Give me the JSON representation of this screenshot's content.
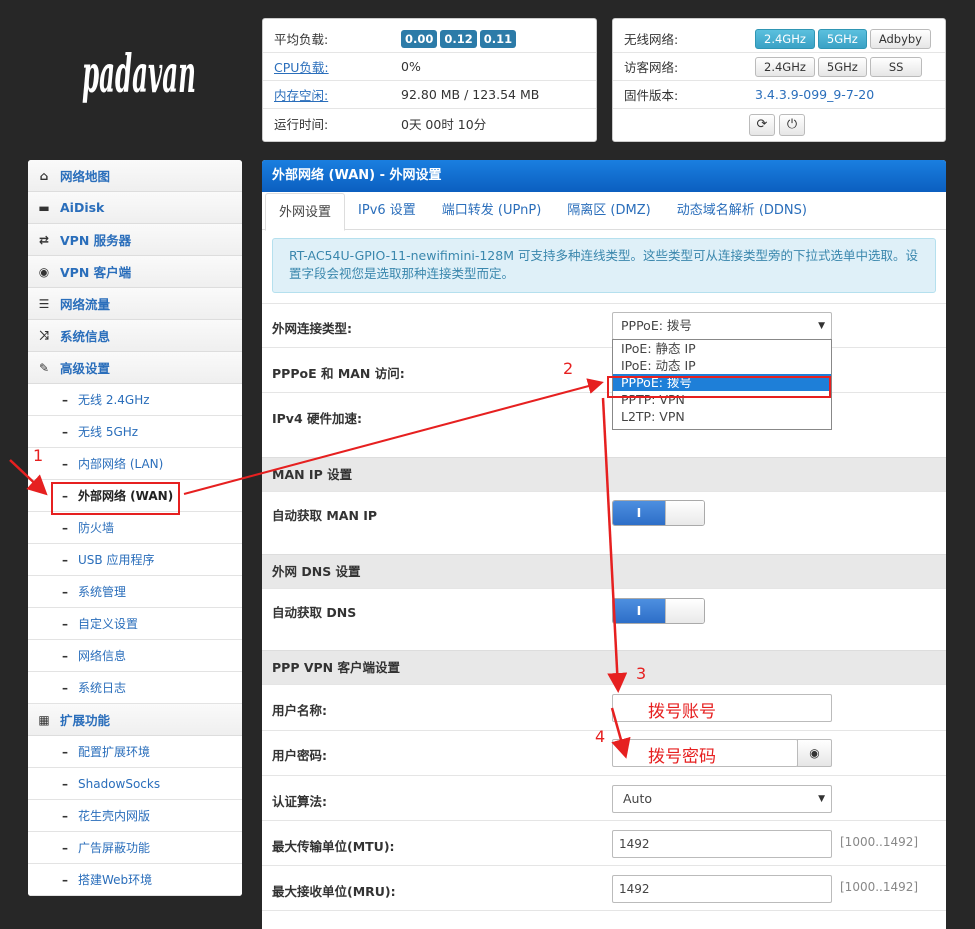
{
  "brand": "padavan",
  "status": {
    "load_label": "平均负载:",
    "load_values": [
      "0.00",
      "0.12",
      "0.11"
    ],
    "cpu_label": "CPU负载:",
    "cpu_value": "0%",
    "mem_label": "内存空闲:",
    "mem_value": "92.80 MB / 123.54 MB",
    "uptime_label": "运行时间:",
    "uptime_value": "0天 00时 10分",
    "wireless_label": "无线网络:",
    "wireless_24": "2.4GHz",
    "wireless_5": "5GHz",
    "adbyby": "Adbyby",
    "guest_label": "访客网络:",
    "guest_24": "2.4GHz",
    "guest_5": "5GHz",
    "ss": "SS",
    "fw_label": "固件版本:",
    "fw_value": "3.4.3.9-099_9-7-20"
  },
  "sidebar": {
    "items": [
      {
        "label": "网络地图",
        "icon": "home-icon",
        "glyph": "⌂"
      },
      {
        "label": "AiDisk",
        "icon": "disk-icon",
        "glyph": "▬"
      },
      {
        "label": "VPN 服务器",
        "icon": "retweet-icon",
        "glyph": "⇄"
      },
      {
        "label": "VPN 客户端",
        "icon": "globe-icon",
        "glyph": "◉"
      },
      {
        "label": "网络流量",
        "icon": "list-icon",
        "glyph": "☰"
      },
      {
        "label": "系统信息",
        "icon": "random-icon",
        "glyph": "⤨"
      },
      {
        "label": "高级设置",
        "icon": "wrench-icon",
        "glyph": "✎"
      }
    ],
    "sub_items": [
      "无线 2.4GHz",
      "无线 5GHz",
      "内部网络 (LAN)",
      "外部网络 (WAN)",
      "防火墙",
      "USB 应用程序",
      "系统管理",
      "自定义设置",
      "网络信息",
      "系统日志"
    ],
    "ext_label": "扩展功能",
    "ext_items": [
      "配置扩展环境",
      "ShadowSocks",
      "花生壳内网版",
      "广告屏蔽功能",
      "搭建Web环境"
    ]
  },
  "main": {
    "header": "外部网络 (WAN) - 外网设置",
    "tabs": [
      "外网设置",
      "IPv6 设置",
      "端口转发 (UPnP)",
      "隔离区 (DMZ)",
      "动态域名解析 (DDNS)"
    ],
    "info": "RT-AC54U-GPIO-11-newifimini-128M 可支持多种连线类型。这些类型可从连接类型旁的下拉式选单中选取。设置字段会视您是选取那种连接类型而定。",
    "wan_type_label": "外网连接类型:",
    "wan_type_value": "PPPoE: 拨号",
    "wan_type_options": [
      "IPoE: 静态 IP",
      "IPoE: 动态 IP",
      "PPPoE: 拨号",
      "PPTP: VPN",
      "L2TP: VPN"
    ],
    "pppoe_man_label": "PPPoE 和 MAN 访问:",
    "ipv4_hw_label": "IPv4 硬件加速:",
    "man_ip_section": "MAN IP 设置",
    "auto_man_ip_label": "自动获取 MAN IP",
    "dns_section": "外网 DNS 设置",
    "auto_dns_label": "自动获取 DNS",
    "ppp_section": "PPP VPN 客户端设置",
    "username_label": "用户名称:",
    "password_label": "用户密码:",
    "auth_label": "认证算法:",
    "auth_value": "Auto",
    "mtu_label": "最大传输单位(MTU):",
    "mtu_value": "1492",
    "mtu_range": "[1000..1492]",
    "mru_label": "最大接收单位(MRU):",
    "mru_value": "1492",
    "mru_range": "[1000..1492]",
    "toggle_on": "I"
  },
  "annotations": {
    "n1": "1",
    "n2": "2",
    "n3": "3",
    "n4": "4",
    "account_hint": "拨号账号",
    "password_hint": "拨号密码"
  }
}
